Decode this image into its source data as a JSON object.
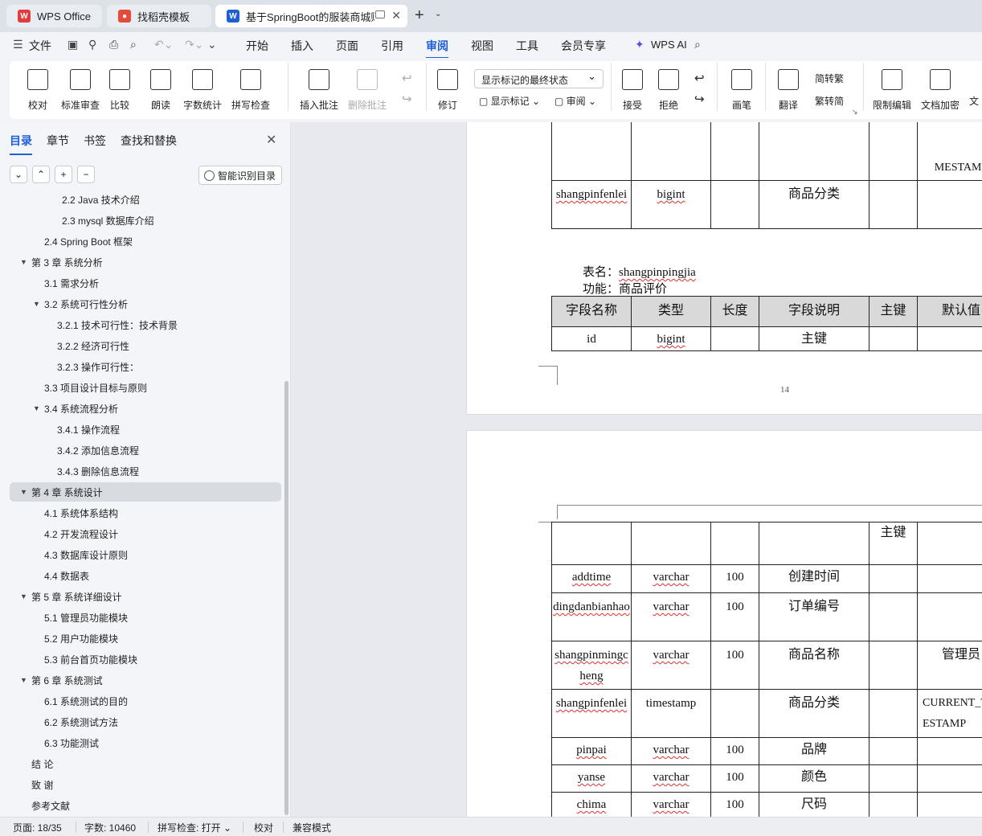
{
  "tabs": [
    {
      "label": "WPS Office",
      "icon": "wps-logo-icon",
      "color": "#e23b3b"
    },
    {
      "label": "找稻壳模板",
      "icon": "docer-logo-icon",
      "color": "#e84a3a"
    },
    {
      "label": "基于SpringBoot的服装商城购物",
      "icon": "word-doc-icon",
      "color": "#1f5fd6"
    }
  ],
  "menu": {
    "file": "文件",
    "items": [
      "开始",
      "插入",
      "页面",
      "引用",
      "审阅",
      "视图",
      "工具",
      "会员专享"
    ],
    "active": "审阅",
    "ai": "WPS AI"
  },
  "ribbon": {
    "proofread": "校对",
    "std_review": "标准审查",
    "compare": "比较",
    "read_aloud": "朗读",
    "word_count": "字数统计",
    "spell_check": "拼写检查",
    "insert_comment": "插入批注",
    "delete_comment": "删除批注",
    "track": "修订",
    "markup_state": "显示标记的最终状态",
    "show_markup": "显示标记",
    "review": "审阅",
    "accept": "接受",
    "reject": "拒绝",
    "pen": "画笔",
    "translate": "翻译",
    "to_trad": "简转繁",
    "to_simp": "繁转简",
    "restrict": "限制编辑",
    "encrypt": "文档加密",
    "more": "文"
  },
  "panel": {
    "tabs": [
      "目录",
      "章节",
      "书签",
      "查找和替换"
    ],
    "smart_btn": "智能识别目录",
    "toc": [
      {
        "text": "2.2  Java 技术介绍",
        "level": 3
      },
      {
        "text": "2.3 mysql 数据库介绍",
        "level": 3
      },
      {
        "text": "2.4 Spring   Boot 框架",
        "level": 2
      },
      {
        "text": "第 3 章  系统分析",
        "level": 1,
        "open": true
      },
      {
        "text": "3.1  需求分析",
        "level": 2
      },
      {
        "text": "3.2  系统可行性分析",
        "level": 2,
        "open": true
      },
      {
        "text": "3.2.1 技术可行性：技术背景",
        "level": 3
      },
      {
        "text": "3.2.2 经济可行性",
        "level": 3
      },
      {
        "text": "3.2.3 操作可行性：",
        "level": 3
      },
      {
        "text": "3.3  项目设计目标与原则",
        "level": 2
      },
      {
        "text": "3.4 系统流程分析",
        "level": 2,
        "open": true
      },
      {
        "text": "3.4.1 操作流程",
        "level": 3
      },
      {
        "text": "3.4.2 添加信息流程",
        "level": 3
      },
      {
        "text": "3.4.3 删除信息流程",
        "level": 3
      },
      {
        "text": "第 4 章  系统设计",
        "level": 1,
        "open": true,
        "selected": true
      },
      {
        "text": "4.1  系统体系结构",
        "level": 2
      },
      {
        "text": "4.2 开发流程设计",
        "level": 2
      },
      {
        "text": "4.3  数据库设计原则",
        "level": 2
      },
      {
        "text": "4.4  数据表",
        "level": 2
      },
      {
        "text": "第 5 章  系统详细设计",
        "level": 1,
        "open": true
      },
      {
        "text": "5.1 管理员功能模块",
        "level": 2
      },
      {
        "text": "5.2 用户功能模块",
        "level": 2
      },
      {
        "text": "5.3 前台首页功能模块",
        "level": 2
      },
      {
        "text": "第 6 章    系统测试",
        "level": 1,
        "open": true
      },
      {
        "text": "6.1 系统测试的目的",
        "level": 2
      },
      {
        "text": "6.2 系统测试方法",
        "level": 2
      },
      {
        "text": "6.3 功能测试",
        "level": 2
      },
      {
        "text": "结   论",
        "level": 1
      },
      {
        "text": "致   谢",
        "level": 1
      },
      {
        "text": "参考文献",
        "level": 1
      }
    ]
  },
  "doc": {
    "p1_row_a": {
      "c6": "MESTAMP"
    },
    "p1_row_b": {
      "c1": "shangpinfenlei",
      "c2": "bigint",
      "c4": "商品分类"
    },
    "table_name_label": "表名：",
    "table_name": "shangpinpingjia",
    "func_label": "功能：",
    "func": "商品评价",
    "headers": [
      "字段名称",
      "类型",
      "长度",
      "字段说明",
      "主键",
      "默认值"
    ],
    "p1_row_c": {
      "c1": "id",
      "c2": "bigint",
      "c4": "主键"
    },
    "page_number": "14",
    "p2_row0": {
      "c5": "主键"
    },
    "p2_rows": [
      {
        "c1": "addtime",
        "c2": "varchar",
        "c3": "100",
        "c4": "创建时间",
        "c5": "",
        "c6": ""
      },
      {
        "c1": "dingdanbianhao",
        "c2": "varchar",
        "c3": "100",
        "c4": "订单编号",
        "c5": "",
        "c6": ""
      },
      {
        "c1": "shangpinmingcheng",
        "c2": "varchar",
        "c3": "100",
        "c4": "商品名称",
        "c5": "",
        "c6": "管理员"
      },
      {
        "c1": "shangpinfenlei",
        "c2": "timestamp",
        "c3": "",
        "c4": "商品分类",
        "c5": "",
        "c6": "CURRENT_TIMESTAMP"
      },
      {
        "c1": "pinpai",
        "c2": "varchar",
        "c3": "100",
        "c4": "品牌",
        "c5": "",
        "c6": ""
      },
      {
        "c1": "yanse",
        "c2": "varchar",
        "c3": "100",
        "c4": "颜色",
        "c5": "",
        "c6": ""
      },
      {
        "c1": "chima",
        "c2": "varchar",
        "c3": "100",
        "c4": "尺码",
        "c5": "",
        "c6": ""
      }
    ]
  },
  "status": {
    "page": "页面: 18/35",
    "words": "字数: 10460",
    "spell": "拼写检查: 打开",
    "proof": "校对",
    "compat": "兼容模式"
  }
}
